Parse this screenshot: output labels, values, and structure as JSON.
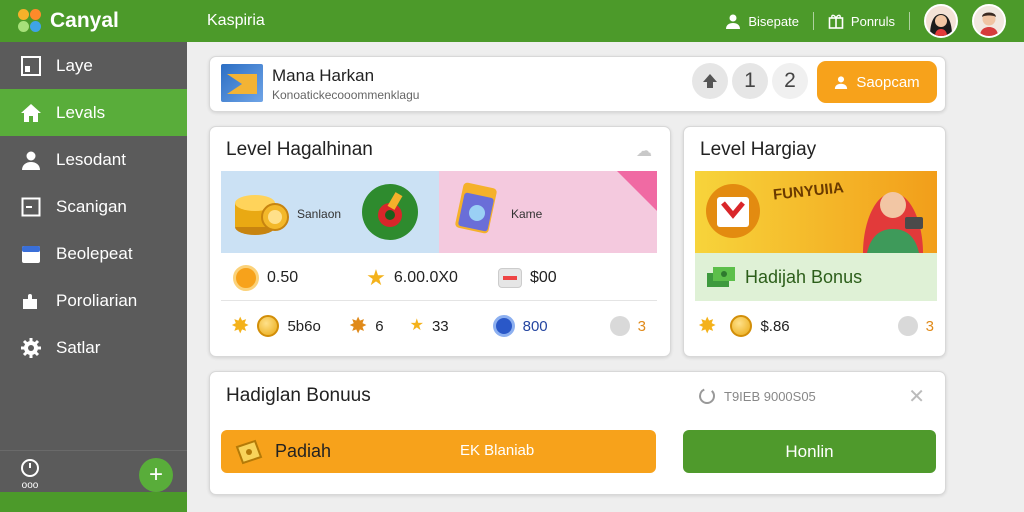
{
  "app": {
    "name": "Canyal",
    "title": "Kaspiria"
  },
  "topbar": {
    "item1": "Bisepate",
    "item2": "Ponruls"
  },
  "sidebar": {
    "items": [
      {
        "label": "Laye",
        "icon": "layout-icon",
        "active": false
      },
      {
        "label": "Levals",
        "icon": "home-icon",
        "active": true
      },
      {
        "label": "Lesodant",
        "icon": "user-icon",
        "active": false
      },
      {
        "label": "Scanigan",
        "icon": "scan-icon",
        "active": false
      },
      {
        "label": "Beolepeat",
        "icon": "calendar-icon",
        "active": false
      },
      {
        "label": "Poroliarian",
        "icon": "puzzle-icon",
        "active": false
      },
      {
        "label": "Satlar",
        "icon": "settings-icon",
        "active": false
      }
    ],
    "bottom_text": "ooo",
    "add_label": "+"
  },
  "header": {
    "title": "Mana Harkan",
    "subtitle": "Konoatickecooommenklagu",
    "num1": "1",
    "num2": "2",
    "save_label": "Saopcam"
  },
  "level": {
    "title": "Level Hagalhinan",
    "tile1_label": "Sanlaon",
    "tile2_label": "Kame",
    "stats": [
      "0.50",
      "6.00.0X0",
      "$00"
    ],
    "icon_row": [
      "5b6o",
      "6",
      "33",
      "800",
      "3"
    ]
  },
  "harian": {
    "title": "Level Hargiay",
    "promo_text": "FUNYUIIA",
    "bonus": "Hadijah Bonus",
    "amount": "$.86",
    "count": "3"
  },
  "bonus": {
    "title": "Hadiglan Bonuus",
    "code": "T9IEB 9000S05",
    "bar_label": "Padiah",
    "bar_mid": "EK Blaniab",
    "button": "Honlin"
  },
  "colors": {
    "green": "#4c9a2a",
    "sidebar": "#5b5b5b",
    "orange": "#f7a21b"
  }
}
